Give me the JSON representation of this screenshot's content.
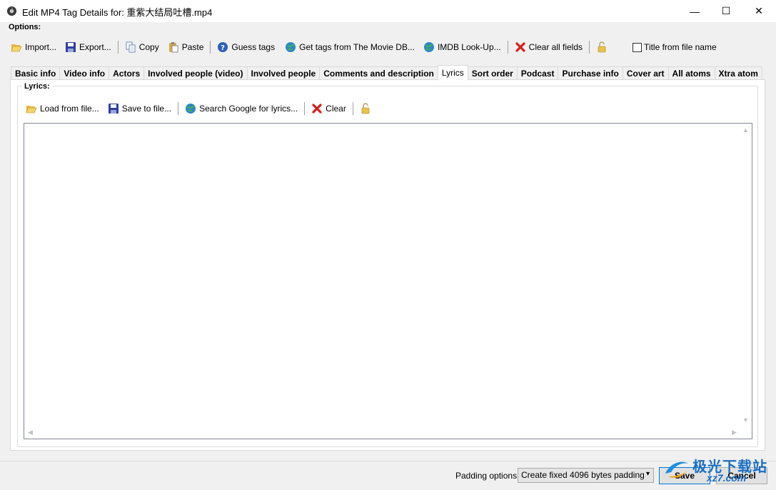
{
  "window": {
    "title": "Edit MP4 Tag Details for: 重紫大结局吐槽.mp4",
    "minimize_glyph": "—",
    "maximize_glyph": "☐",
    "close_glyph": "✕"
  },
  "options_label": "Options:",
  "toolbar": {
    "import_label": "Import...",
    "export_label": "Export...",
    "copy_label": "Copy",
    "paste_label": "Paste",
    "guess_label": "Guess tags",
    "moviedb_label": "Get tags from The Movie DB...",
    "imdb_label": "IMDB Look-Up...",
    "clear_all_label": "Clear all fields",
    "title_from_file_label": "Title from file name"
  },
  "tabs": [
    {
      "label": "Basic info",
      "active": false
    },
    {
      "label": "Video info",
      "active": false
    },
    {
      "label": "Actors",
      "active": false
    },
    {
      "label": "Involved people (video)",
      "active": false
    },
    {
      "label": "Involved people",
      "active": false
    },
    {
      "label": "Comments and description",
      "active": false
    },
    {
      "label": "Lyrics",
      "active": true
    },
    {
      "label": "Sort order",
      "active": false
    },
    {
      "label": "Podcast",
      "active": false
    },
    {
      "label": "Purchase info",
      "active": false
    },
    {
      "label": "Cover art",
      "active": false
    },
    {
      "label": "All atoms",
      "active": false
    },
    {
      "label": "Xtra atom",
      "active": false
    }
  ],
  "lyrics": {
    "group_label": "Lyrics:",
    "load_label": "Load from file...",
    "save_label": "Save to file...",
    "search_label": "Search Google for lyrics...",
    "clear_label": "Clear",
    "text": ""
  },
  "bottom": {
    "padding_label": "Padding options:",
    "padding_value": "Create fixed 4096 bytes padding",
    "save_label": "Save",
    "cancel_label": "Cancel"
  },
  "watermark": {
    "text": "极光下载站",
    "url": "xz7.com"
  },
  "colors": {
    "accent": "#0078d7",
    "clear_red": "#d81e1e",
    "watermark": "#1a6fc4"
  }
}
